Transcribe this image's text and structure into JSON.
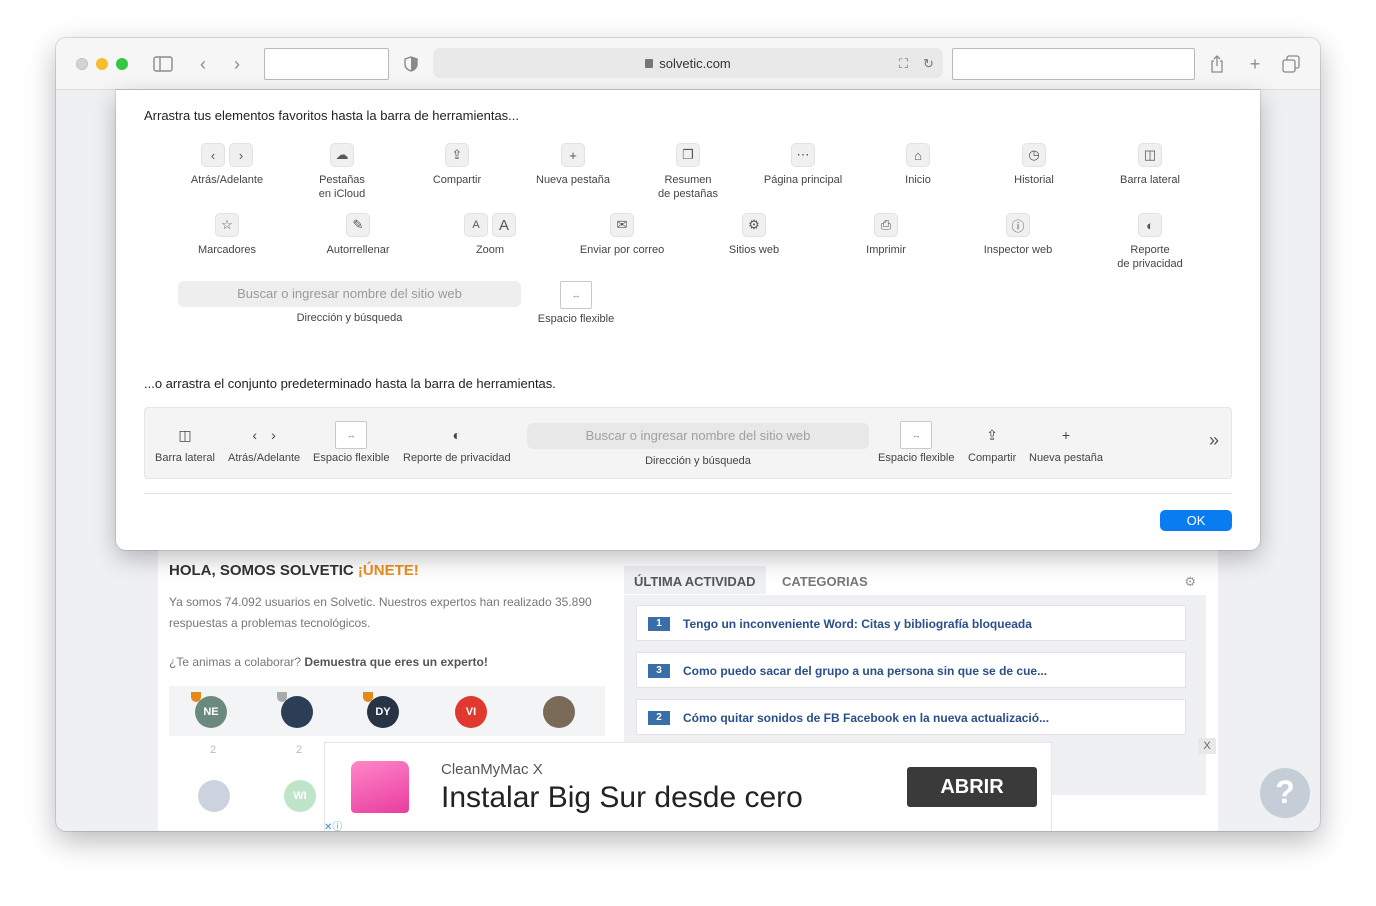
{
  "browser": {
    "address": "solvetic.com"
  },
  "sheet": {
    "title": "Arrastra tus elementos favoritos hasta la barra de herramientas...",
    "row1": [
      {
        "label": "Atrás/Adelante",
        "icon": "back-forward-icon"
      },
      {
        "label": "Pestañas\nen iCloud",
        "icon": "cloud-icon"
      },
      {
        "label": "Compartir",
        "icon": "share-icon"
      },
      {
        "label": "Nueva pestaña",
        "icon": "plus-icon"
      },
      {
        "label": "Resumen\nde pestañas",
        "icon": "tab-overview-icon"
      },
      {
        "label": "Página principal",
        "icon": "grid-icon"
      },
      {
        "label": "Inicio",
        "icon": "home-icon"
      },
      {
        "label": "Historial",
        "icon": "clock-icon"
      },
      {
        "label": "Barra lateral",
        "icon": "sidebar-icon"
      }
    ],
    "row2": [
      {
        "label": "Marcadores",
        "icon": "star-icon"
      },
      {
        "label": "Autorrellenar",
        "icon": "autofill-icon"
      },
      {
        "label": "Zoom",
        "icon": "zoom-icon"
      },
      {
        "label": "Enviar por correo",
        "icon": "mail-icon"
      },
      {
        "label": "Sitios web",
        "icon": "gear-icon"
      },
      {
        "label": "Imprimir",
        "icon": "print-icon"
      },
      {
        "label": "Inspector web",
        "icon": "info-icon"
      },
      {
        "label": "Reporte\nde privacidad",
        "icon": "privacy-shield-icon"
      }
    ],
    "search_placeholder": "Buscar o ingresar nombre del sitio web",
    "search_label": "Dirección y búsqueda",
    "flex_label": "Espacio flexible",
    "subtitle": "...o arrastra el conjunto predeterminado hasta la barra de herramientas.",
    "default_items": {
      "sidebar": "Barra lateral",
      "back_forward": "Atrás/Adelante",
      "flex1": "Espacio flexible",
      "privacy": "Reporte de privacidad",
      "search_placeholder": "Buscar o ingresar nombre del sitio web",
      "search_label": "Dirección y búsqueda",
      "flex2": "Espacio flexible",
      "share": "Compartir",
      "new_tab": "Nueva pestaña"
    },
    "ok": "OK"
  },
  "page": {
    "hola": "HOLA, SOMOS SOLVETIC",
    "join": "¡ÚNETE!",
    "desc": "Ya somos 74.092 usuarios en Solvetic. Nuestros expertos han realizado 35.890 respuestas a problemas tecnológicos.",
    "anim_q": "¿Te animas a colaborar?",
    "anim_b": "Demuestra que eres un experto!",
    "avatars": [
      "NE",
      "DY",
      "VI",
      "WI"
    ],
    "counts": [
      "2",
      "2"
    ],
    "tab_active": "ÚLTIMA ACTIVIDAD",
    "tab_other": "CATEGORIAS",
    "activity": [
      {
        "n": "1",
        "t": "Tengo un inconveniente Word: Citas y bibliografía bloqueada"
      },
      {
        "n": "3",
        "t": "Como puedo sacar del grupo a una persona sin que se de cue..."
      },
      {
        "n": "2",
        "t": "Cómo quitar sonidos de FB Facebook en la nueva actualizació..."
      }
    ],
    "ad_small": "CleanMyMac X",
    "ad_big": "Instalar Big Sur desde cero",
    "ad_btn": "ABRIR",
    "ad_close": "X"
  }
}
